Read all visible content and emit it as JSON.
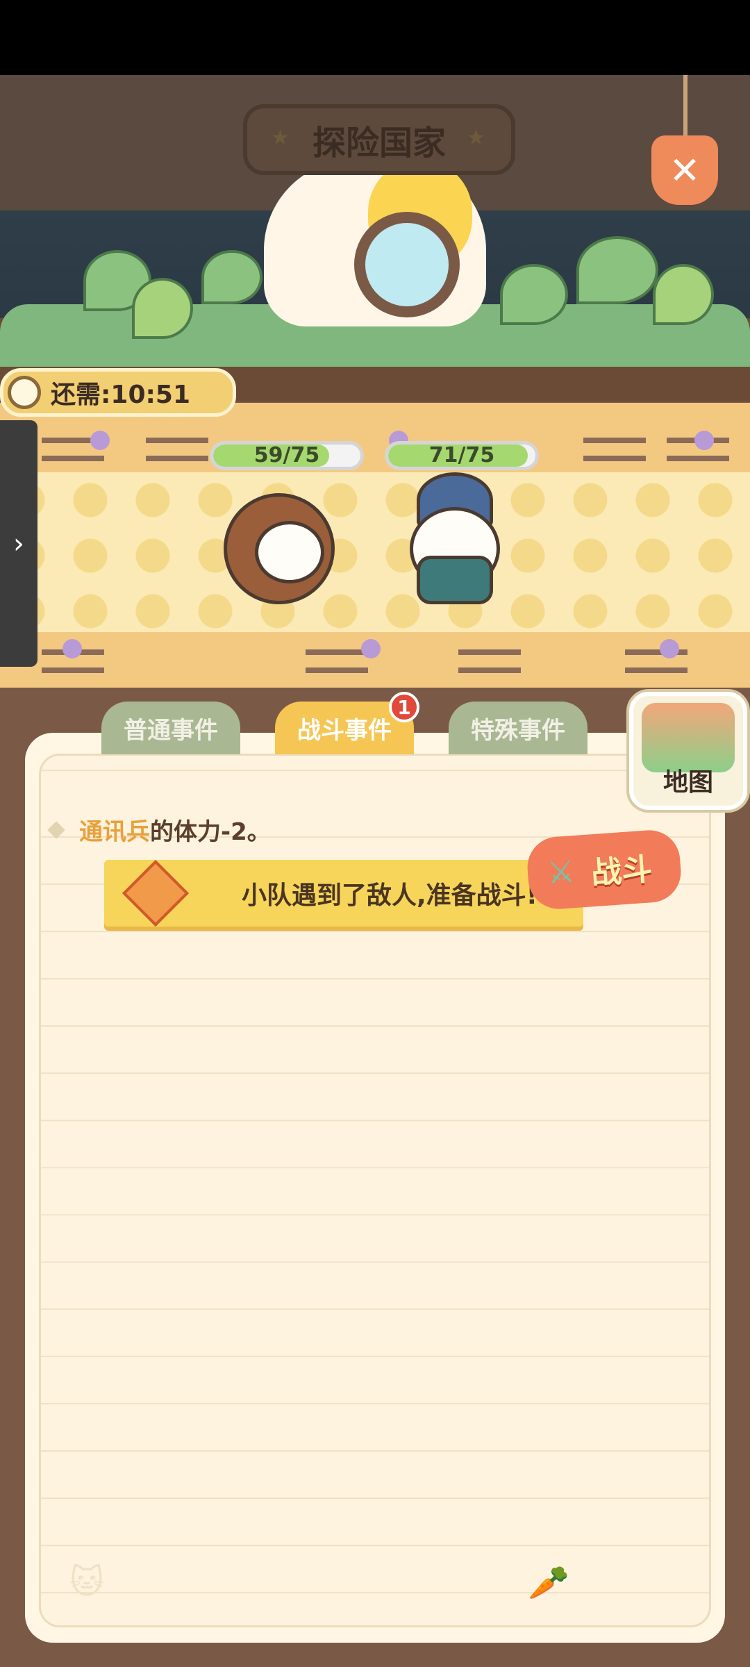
{
  "header": {
    "title": "探险国家"
  },
  "timer": {
    "label": "还需:10:51"
  },
  "party": [
    {
      "hp_text": "59/75",
      "hp_fraction": 0.787
    },
    {
      "hp_text": "71/75",
      "hp_fraction": 0.947
    }
  ],
  "tabs": [
    {
      "label": "普通事件",
      "active": false
    },
    {
      "label": "战斗事件",
      "active": true,
      "badge": "1"
    },
    {
      "label": "特殊事件",
      "active": false
    }
  ],
  "map_button": {
    "label": "地图"
  },
  "log": {
    "event_name": "通讯兵",
    "event_text": "的体力-2。",
    "banner_text": "小队遇到了敌人,准备战斗!",
    "stamp_label": "战斗"
  },
  "colors": {
    "accent": "#f6c655",
    "badge": "#e04a3a",
    "hp_fill": "#a5d86f"
  },
  "icons": {
    "close": "close-icon",
    "clock": "clock-icon",
    "side": "chevron-right-icon"
  }
}
